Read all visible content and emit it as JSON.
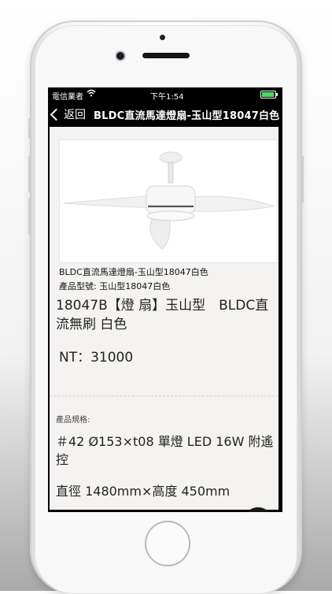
{
  "status_bar": {
    "carrier": "電信業者",
    "time": "下午1:54",
    "wifi_icon": "wifi-icon",
    "battery_icon": "battery-icon"
  },
  "nav": {
    "back_label": "返回",
    "title": "BLDC直流馬達燈扇-玉山型18047白色"
  },
  "product": {
    "name_line": "BLDC直流馬達燈扇-玉山型18047白色",
    "model_line": "產品型號: 玉山型18047白色",
    "headline": "18047B【燈 扇】玉山型　BLDC直流無刷  白色",
    "price": "NT：31000"
  },
  "specs": {
    "title": "產品規格:",
    "line1": "＃42 Ø153×t08 單燈 LED 16W 附遙控",
    "line2": "直徑 1480mm×高度 450mm"
  },
  "colors": {
    "screen_bg": "#f4f3f1",
    "nav_bg": "#000000",
    "fab_bg": "#151515"
  },
  "icons": {
    "back": "chevron-left-icon",
    "home_fab": "home-icon"
  }
}
